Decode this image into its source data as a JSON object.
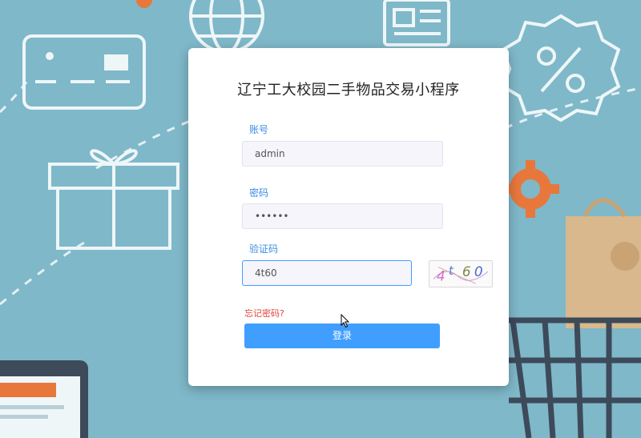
{
  "app": {
    "title": "辽宁工大校园二手物品交易小程序"
  },
  "form": {
    "account_label": "账号",
    "account_value": "admin",
    "password_label": "密码",
    "password_value": "••••••",
    "captcha_label": "验证码",
    "captcha_value": "4t60",
    "captcha_image_text": [
      "4",
      "t",
      "6",
      "0"
    ],
    "forgot_label": "忘记密码?",
    "login_label": "登录"
  },
  "colors": {
    "background": "#7fb8c9",
    "accent": "#409eff",
    "label": "#3a8ee6",
    "forgot": "#e0453a"
  },
  "background_icons": [
    "credit-card-icon",
    "globe-icon",
    "newspaper-icon",
    "percent-badge-icon",
    "gift-box-icon",
    "gear-icon",
    "shopping-bag-icon",
    "shopping-cart-icon",
    "tablet-icon"
  ]
}
